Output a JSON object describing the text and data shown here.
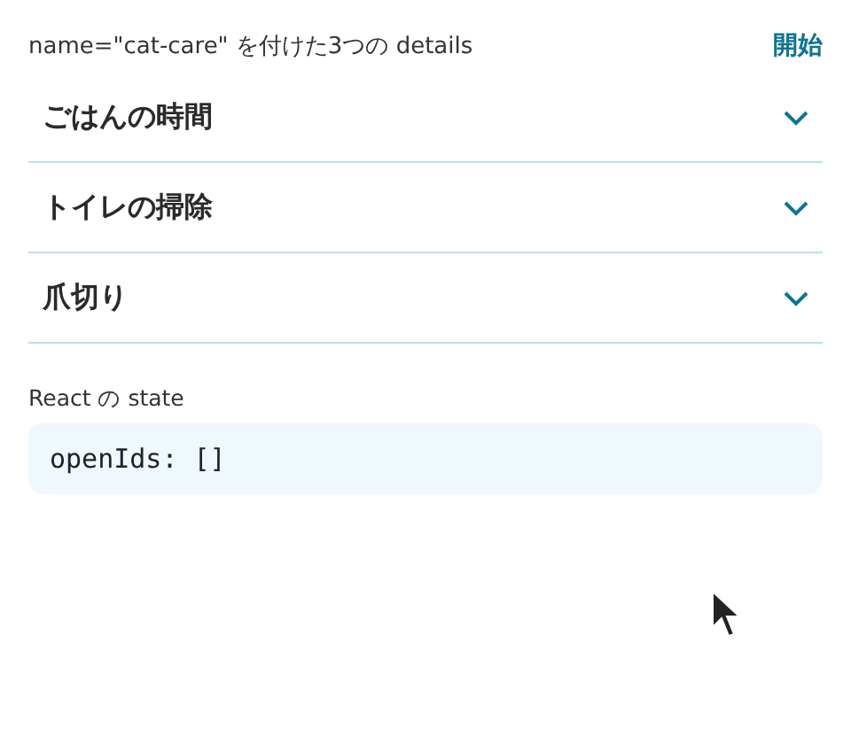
{
  "header": {
    "caption": "name=\"cat-care\" を付けた3つの details",
    "action": "開始"
  },
  "details": [
    {
      "title": "ごはんの時間",
      "expanded": false
    },
    {
      "title": "トイレの掃除",
      "expanded": false
    },
    {
      "title": "爪切り",
      "expanded": false
    }
  ],
  "state_panel": {
    "label": "React の state",
    "code": "openIds: []"
  }
}
